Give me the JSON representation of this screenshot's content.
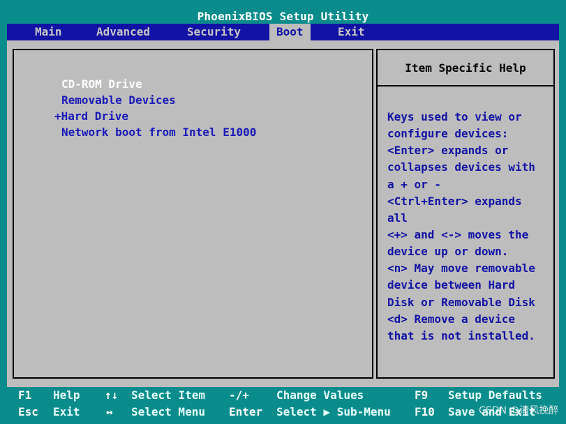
{
  "title": "PhoenixBIOS Setup Utility",
  "menu": [
    {
      "label": "Main",
      "active": false
    },
    {
      "label": "Advanced",
      "active": false
    },
    {
      "label": "Security",
      "active": false
    },
    {
      "label": "Boot",
      "active": true
    },
    {
      "label": "Exit",
      "active": false
    }
  ],
  "boot_items": [
    {
      "label": "CD-ROM Drive",
      "selected": true
    },
    {
      "label": "Removable Devices",
      "selected": false
    },
    {
      "label": "+Hard Drive",
      "selected": false
    },
    {
      "label": "Network boot from Intel E1000",
      "selected": false
    }
  ],
  "help": {
    "title": "Item Specific Help",
    "lines": [
      "Keys used to view or",
      "configure devices:",
      "<Enter> expands or",
      "collapses devices with",
      "a + or -",
      "<Ctrl+Enter> expands",
      "all",
      "<+> and <-> moves the",
      "device up or down.",
      "<n> May move removable",
      "device between Hard",
      "Disk or Removable Disk",
      "<d> Remove a device",
      "that is not installed."
    ]
  },
  "footer": {
    "row1": {
      "key1": "F1",
      "label1": "Help",
      "key2": "↑↓",
      "label2": "Select Item",
      "key3": "-/+",
      "label3": "Change Values",
      "key4": "F9",
      "label4": "Setup Defaults"
    },
    "row2": {
      "key1": "Esc",
      "label1": "Exit",
      "key2": "↔",
      "label2": "Select Menu",
      "key3": "Enter",
      "label3": "Select ▶ Sub-Menu",
      "key4": "F10",
      "label4": "Save and Exit"
    }
  },
  "watermark": "CSDN @清风挽醉",
  "colors": {
    "cyan": "#0a8c8c",
    "menubar": "#1212a4",
    "grey": "#bdbdbd",
    "item_text": "#1a1ab8",
    "selected_text": "#ffffff"
  }
}
